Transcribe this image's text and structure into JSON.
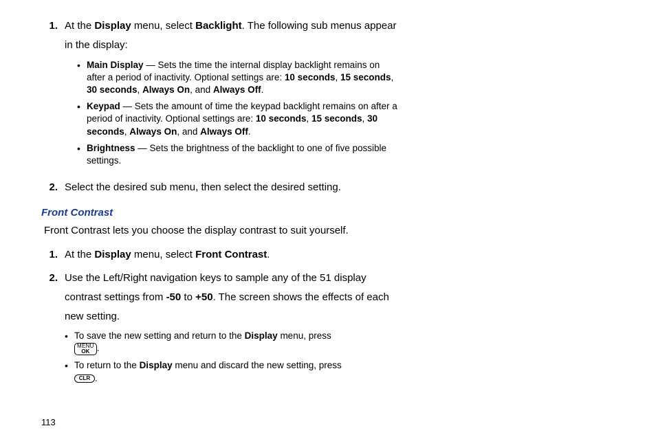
{
  "step1": {
    "num": "1.",
    "text_pre": "At the ",
    "bold1": "Display",
    "text_mid": " menu, select ",
    "bold2": "Backlight",
    "text_post": ". The following sub menus appear in the display:"
  },
  "bullets1": {
    "main": {
      "label": "Main Display",
      "dash": " — ",
      "text1": "Sets the time the internal display backlight remains on after a period of inactivity. Optional settings are: ",
      "opt1": "10 seconds",
      "c1": ", ",
      "opt2": "15 seconds",
      "c2": ", ",
      "opt3": "30 seconds",
      "c3": ", ",
      "opt4": "Always On",
      "c4": ", and ",
      "opt5": "Always Off",
      "period": "."
    },
    "keypad": {
      "label": "Keypad",
      "dash": " — ",
      "text1": "Sets the amount of time the keypad backlight remains on after a period of inactivity. Optional settings are: ",
      "opt1": "10 seconds",
      "c1": ", ",
      "opt2": "15 seconds",
      "c2": ", ",
      "opt3": "30 seconds",
      "c3": ", ",
      "opt4": "Always On",
      "c4": ", and ",
      "opt5": "Always Off",
      "period": "."
    },
    "brightness": {
      "label": "Brightness",
      "dash": " — ",
      "text": "Sets the brightness of the backlight to one of five possible settings."
    }
  },
  "step2": {
    "num": "2.",
    "text": "Select the desired sub menu, then select the desired setting."
  },
  "section": {
    "title": "Front Contrast",
    "para": "Front Contrast lets you choose the display contrast to suit yourself."
  },
  "step3": {
    "num": "1.",
    "text_pre": "At the ",
    "bold1": "Display",
    "text_mid": " menu, select ",
    "bold2": "Front Contrast",
    "text_post": "."
  },
  "step4": {
    "num": "2.",
    "text1": "Use the Left/Right navigation keys to sample any of the 51 display contrast settings from ",
    "bold1": "-50",
    "text2": " to ",
    "bold2": "+50",
    "text3": ". The screen shows the effects of each new setting."
  },
  "bullets2": {
    "save": {
      "text1": "To save the new setting and return to the ",
      "bold": "Display",
      "text2": " menu, press ",
      "period": "."
    },
    "ret": {
      "text1": "To return to the ",
      "bold": "Display",
      "text2": " menu and discard the new setting, press ",
      "period": "."
    }
  },
  "keys": {
    "menu_top": "MENU",
    "menu_bot": "OK",
    "clr": "CLR"
  },
  "glyphs": {
    "bullet": "•"
  },
  "page_number": "113"
}
